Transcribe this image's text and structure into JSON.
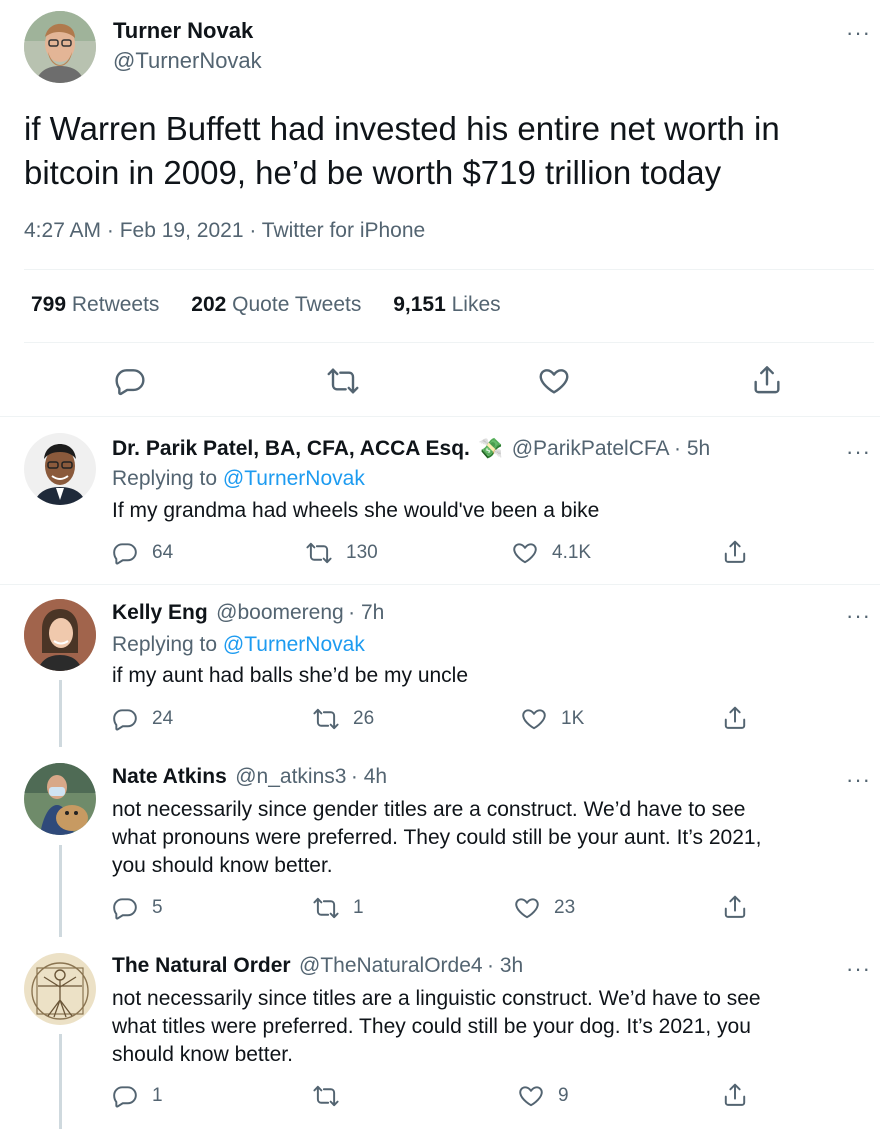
{
  "main_tweet": {
    "author_name": "Turner Novak",
    "author_handle": "@TurnerNovak",
    "text_line1": "if Warren Buffett had invested his entire net worth in",
    "text_line2": "bitcoin in 2009, he’d be worth $719 trillion today",
    "time": "4:27 AM",
    "date": "Feb 19, 2021",
    "source": "Twitter for iPhone",
    "sep": " · ",
    "more": "···",
    "stats": {
      "retweets_count": "799",
      "retweets_label": "Retweets",
      "quotes_count": "202",
      "quotes_label": "Quote Tweets",
      "likes_count": "9,151",
      "likes_label": "Likes"
    },
    "actions": [
      "reply-icon",
      "retweet-icon",
      "like-icon",
      "share-icon"
    ]
  },
  "replies": [
    {
      "name": "Dr. Parik Patel, BA, CFA, ACCA Esq.",
      "emoji": "💸",
      "handle": "@ParikPatelCFA",
      "time": "· 5h",
      "replying_label": "Replying to",
      "replying_to": "@TurnerNovak",
      "text": [
        "If my grandma had wheels she would've been a bike"
      ],
      "replies": "64",
      "retweets": "130",
      "likes": "4.1K",
      "more": "···"
    },
    {
      "name": "Kelly Eng",
      "handle": "@boomereng",
      "time": "· 7h",
      "replying_label": "Replying to",
      "replying_to": "@TurnerNovak",
      "text": [
        "if my aunt had balls she’d be my uncle"
      ],
      "replies": "24",
      "retweets": "26",
      "likes": "1K",
      "more": "···"
    },
    {
      "name": "Nate Atkins",
      "handle": "@n_atkins3",
      "time": "· 4h",
      "text": [
        "not necessarily since gender titles are a construct. We’d have to see",
        "what pronouns were preferred. They could still be your aunt. It’s 2021,",
        "you should know better."
      ],
      "replies": "5",
      "retweets": "1",
      "likes": "23",
      "more": "···"
    },
    {
      "name": "The Natural Order",
      "handle": "@TheNaturalOrde4",
      "time": "· 3h",
      "text": [
        "not necessarily since titles are a linguistic construct. We’d have to see",
        "what titles were preferred. They could still be your dog. It’s 2021, you",
        "should know better."
      ],
      "replies": "1",
      "retweets": "",
      "likes": "9",
      "more": "···"
    }
  ],
  "colors": {
    "text": "#0f1419",
    "secondary": "#536471",
    "link": "#1d9bf0",
    "divider": "#eff3f4",
    "thread": "#cfd9de"
  }
}
